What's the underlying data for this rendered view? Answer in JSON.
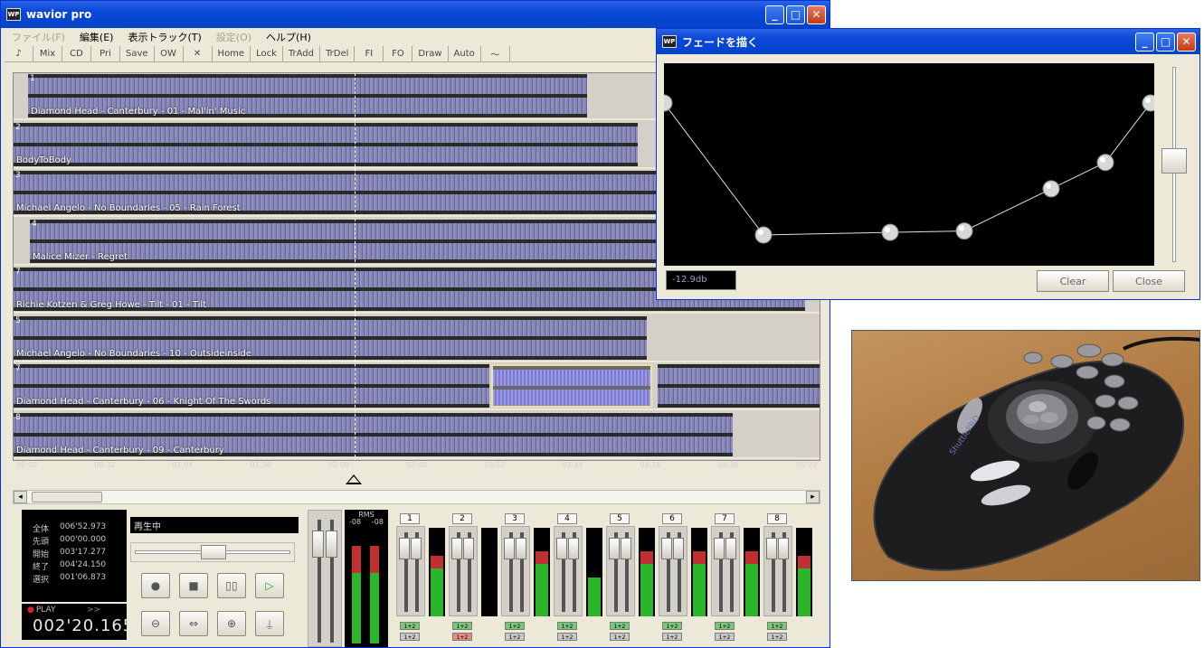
{
  "main_window": {
    "title": "wavior pro",
    "icon_text": "WP",
    "menu": [
      "ファイル(F)",
      "編集(E)",
      "表示トラック(T)",
      "設定(O)",
      "ヘルプ(H)"
    ],
    "menu_disabled": [
      true,
      false,
      false,
      true,
      false
    ],
    "toolbar": [
      "♪",
      "Mix",
      "CD",
      "Pri",
      "Save",
      "OW",
      "✕",
      "Home",
      "Lock",
      "TrAdd",
      "TrDel",
      "FI",
      "FO",
      "Draw",
      "Auto",
      "〜"
    ]
  },
  "tracks": [
    {
      "num": "1",
      "label": "Diamond Head - Canterbury - 01 - Mal'in' Music"
    },
    {
      "num": "2",
      "label": "BodyToBody"
    },
    {
      "num": "3",
      "label": "Michael Angelo - No Boundaries - 05 - Rain Forest"
    },
    {
      "num": "4",
      "label": "Malice Mizer - Regret"
    },
    {
      "num": "7",
      "label": "Richie Kotzen & Greg Howe - Tilt - 01 - Tilt"
    },
    {
      "num": "5",
      "label": "Michael Angelo - No Boundaries - 10 - Outsideinside"
    },
    {
      "num": "7",
      "label": "Diamond Head - Canterbury - 06 - Knight Of The Swords"
    },
    {
      "num": "8",
      "label": "Diamond Head - Canterbury - 09 - Canterbury"
    }
  ],
  "timeline": [
    "00:00",
    "00:32",
    "01:04",
    "01:36",
    "02:08",
    "02:40",
    "03:12",
    "03:44",
    "04:16",
    "04:48",
    "05:20"
  ],
  "transport": {
    "rows": [
      {
        "label": "全体",
        "value": "006'52.973"
      },
      {
        "label": "先頭",
        "value": "000'00.000"
      },
      {
        "label": "開始",
        "value": "003'17.277"
      },
      {
        "label": "終了",
        "value": "004'24.150"
      },
      {
        "label": "選択",
        "value": "001'06.873"
      }
    ],
    "play_label": "PLAY",
    "play_arrows": ">>",
    "play_time": "002'20.165",
    "status": "再生中",
    "position_fraction": 0.5
  },
  "buttons": {
    "record": "●",
    "stop": "■",
    "pause": "▯▯",
    "play": "▷",
    "minus": "⊖",
    "loop": "⇔",
    "plus": "⊕",
    "mark": "⍊"
  },
  "rms": {
    "title": "RMS",
    "left": "-08",
    "right": "-08"
  },
  "channels": [
    {
      "num": "1",
      "tag_a": "1+2",
      "tag_b": "1+2",
      "level": 0.55
    },
    {
      "num": "2",
      "tag_a": "1+2",
      "tag_b": "1+2",
      "level": 0.0
    },
    {
      "num": "3",
      "tag_a": "1+2",
      "tag_b": "1+2",
      "level": 0.6
    },
    {
      "num": "4",
      "tag_a": "1+2",
      "tag_b": "1+2",
      "level": 0.45
    },
    {
      "num": "5",
      "tag_a": "1+2",
      "tag_b": "1+2",
      "level": 0.6
    },
    {
      "num": "6",
      "tag_a": "1+2",
      "tag_b": "1+2",
      "level": 0.6
    },
    {
      "num": "7",
      "tag_a": "1+2",
      "tag_b": "1+2",
      "level": 0.6
    },
    {
      "num": "8",
      "tag_a": "1+2",
      "tag_b": "1+2",
      "level": 0.55
    }
  ],
  "fade_dialog": {
    "title": "フェードを描く",
    "icon_text": "WP",
    "db_value": "-12.9db",
    "clear_label": "Clear",
    "close_label": "Close",
    "fade_points": [
      1.0,
      0.0,
      0.02,
      0.03,
      0.35,
      0.55,
      1.0
    ]
  },
  "photo": {
    "brand_text": "ShuttlePRO"
  }
}
